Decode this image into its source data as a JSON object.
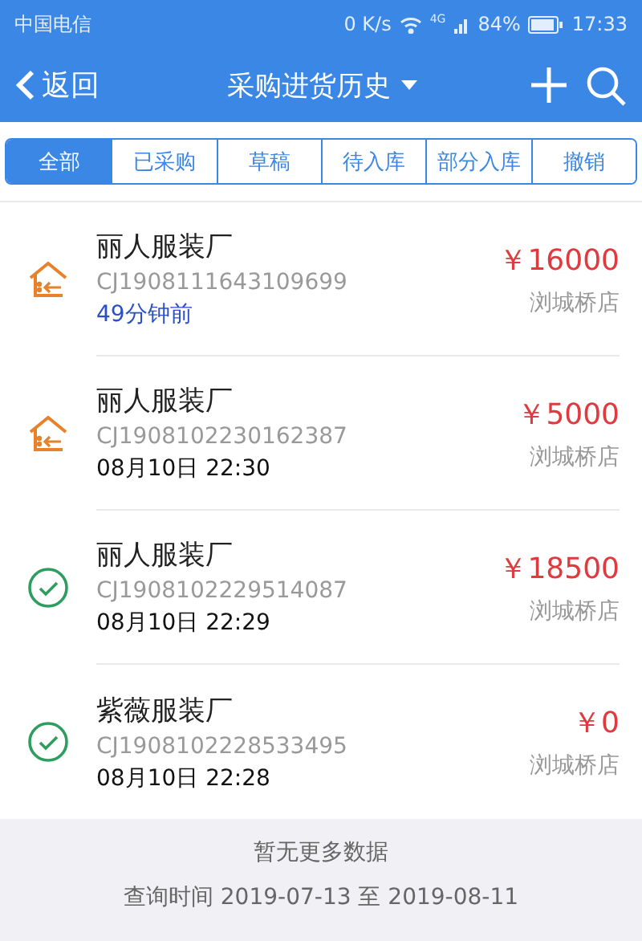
{
  "status_bar": {
    "carrier": "中国电信",
    "speed": "0 K/s",
    "network": "4G",
    "battery": "84%",
    "time": "17:33"
  },
  "nav": {
    "back": "返回",
    "title": "采购进货历史"
  },
  "tabs": [
    {
      "label": "全部",
      "selected": true
    },
    {
      "label": "已采购",
      "selected": false
    },
    {
      "label": "草稿",
      "selected": false
    },
    {
      "label": "待入库",
      "selected": false
    },
    {
      "label": "部分入库",
      "selected": false
    },
    {
      "label": "撤销",
      "selected": false
    }
  ],
  "orders": [
    {
      "kind": "pending",
      "supplier": "丽人服装厂",
      "code": "CJ1908111643109699",
      "time": "49分钟前",
      "recent": true,
      "amount": "￥16000",
      "store": "浏城桥店"
    },
    {
      "kind": "pending",
      "supplier": "丽人服装厂",
      "code": "CJ1908102230162387",
      "time": "08月10日 22:30",
      "recent": false,
      "amount": "￥5000",
      "store": "浏城桥店"
    },
    {
      "kind": "done",
      "supplier": "丽人服装厂",
      "code": "CJ1908102229514087",
      "time": "08月10日 22:29",
      "recent": false,
      "amount": "￥18500",
      "store": "浏城桥店"
    },
    {
      "kind": "done",
      "supplier": "紫薇服装厂",
      "code": "CJ1908102228533495",
      "time": "08月10日 22:28",
      "recent": false,
      "amount": "￥0",
      "store": "浏城桥店"
    }
  ],
  "footer": {
    "message": "暂无更多数据",
    "range": "查询时间 2019-07-13 至 2019-08-11"
  }
}
